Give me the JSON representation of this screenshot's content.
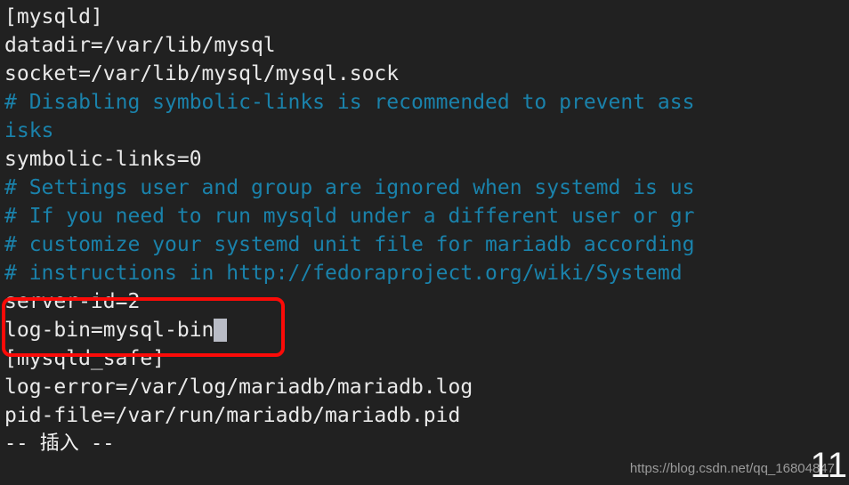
{
  "terminal": {
    "background_color": "#212121",
    "foreground_color": "#e8e8e8",
    "comment_color": "#1a82ab",
    "cursor_color": "#b9bcc6",
    "lines": [
      {
        "text": "[mysqld]",
        "style": "plain"
      },
      {
        "text": "datadir=/var/lib/mysql",
        "style": "plain"
      },
      {
        "text": "socket=/var/lib/mysql/mysql.sock",
        "style": "plain"
      },
      {
        "text": "# Disabling symbolic-links is recommended to prevent ass",
        "style": "comment"
      },
      {
        "text": "isks",
        "style": "comment"
      },
      {
        "text": "symbolic-links=0",
        "style": "plain"
      },
      {
        "text": "# Settings user and group are ignored when systemd is us",
        "style": "comment"
      },
      {
        "text": "# If you need to run mysqld under a different user or gr",
        "style": "comment"
      },
      {
        "text": "# customize your systemd unit file for mariadb according",
        "style": "comment"
      },
      {
        "text": "# instructions in http://fedoraproject.org/wiki/Systemd",
        "style": "comment"
      },
      {
        "text": "server-id=2",
        "style": "plain"
      },
      {
        "text": "log-bin=mysql-bin",
        "style": "plain",
        "cursor": true
      },
      {
        "text": "[mysqld_safe]",
        "style": "plain"
      },
      {
        "text": "log-error=/var/log/mariadb/mariadb.log",
        "style": "plain"
      },
      {
        "text": "pid-file=/var/run/mariadb/mariadb.pid",
        "style": "plain"
      }
    ],
    "status_line": "-- 插入 --"
  },
  "annotation": {
    "color": "#fb0b08",
    "target_lines": [
      "server-id=2",
      "log-bin=mysql-bin"
    ]
  },
  "watermark": {
    "url": "https://blog.csdn.net/qq_16804847",
    "page_number": "11"
  }
}
